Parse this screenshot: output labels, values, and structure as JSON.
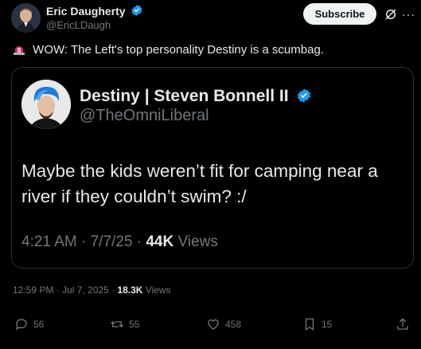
{
  "post": {
    "author_name": "Eric Daugherty",
    "author_handle": "@EricLDaugh",
    "subscribe_label": "Subscribe",
    "more_label": "···",
    "text": "WOW: The Left's top personality Destiny is a scumbag.",
    "timestamp": "12:59 PM · Jul 7, 2025 · ",
    "views_count": "18.3K",
    "views_label": "Views"
  },
  "quote": {
    "name": "Destiny | Steven Bonnell II",
    "handle": "@TheOmniLiberal",
    "text": "Maybe the kids weren’t fit for camping near a river if they couldn’t swim? :/",
    "meta_time": "4:21 AM · 7/7/25 · ",
    "meta_views": "44K",
    "meta_views_label": " Views"
  },
  "actions": {
    "replies": "56",
    "reposts": "55",
    "likes": "458",
    "bookmarks": "15"
  },
  "colors": {
    "verified": "#1d9bf0",
    "background": "#000000",
    "muted": "#71767b"
  }
}
